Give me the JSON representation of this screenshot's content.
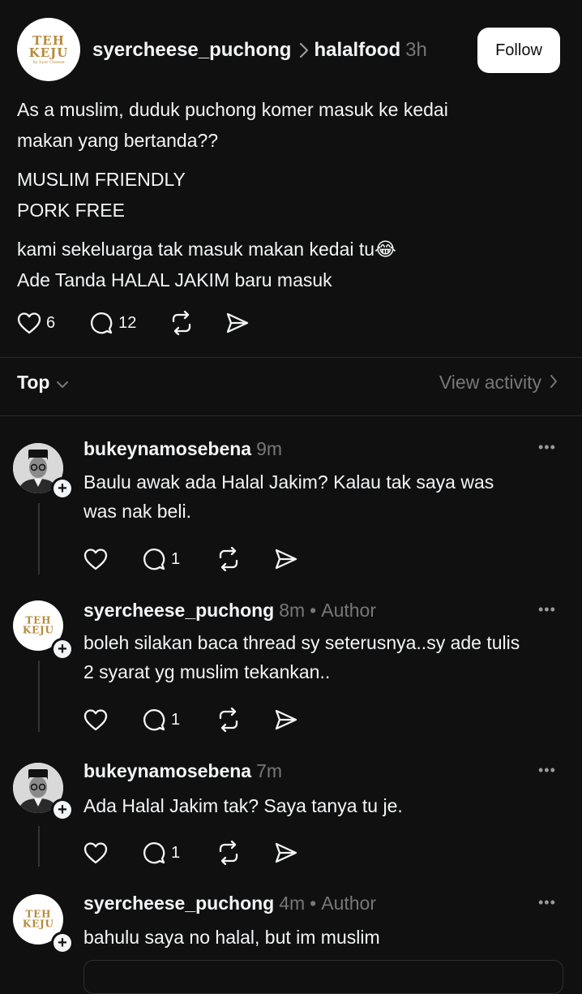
{
  "post": {
    "username": "syercheese_puchong",
    "topic": "halalfood",
    "time": "3h",
    "follow_label": "Follow",
    "avatar_logo": {
      "line1": "TEH",
      "line2": "KEJU",
      "line3": "by Syer Cheese"
    },
    "paragraphs": [
      [
        "As a muslim, duduk puchong komer masuk ke kedai",
        "makan yang bertanda??"
      ],
      [
        "MUSLIM FRIENDLY",
        "PORK FREE"
      ],
      [
        "kami sekeluarga tak masuk makan kedai tu😂",
        "Ade Tanda HALAL JAKIM baru masuk"
      ]
    ],
    "likes": "6",
    "comments": "12"
  },
  "sort": {
    "label": "Top",
    "view_activity": "View activity"
  },
  "replies": [
    {
      "username": "bukeynamosebena",
      "time": "9m",
      "author_tag": "",
      "lines": [
        "Baulu awak ada Halal Jakim? Kalau tak saya was",
        "was nak beli."
      ],
      "likes": "",
      "comments": "1"
    },
    {
      "username": "syercheese_puchong",
      "time": "8m",
      "author_tag": "Author",
      "lines": [
        "boleh silakan baca thread sy seterusnya..sy ade tulis",
        "2 syarat yg muslim tekankan.."
      ],
      "likes": "",
      "comments": "1"
    },
    {
      "username": "bukeynamosebena",
      "time": "7m",
      "author_tag": "",
      "lines": [
        "Ada Halal Jakim tak? Saya tanya tu je."
      ],
      "likes": "",
      "comments": "1"
    },
    {
      "username": "syercheese_puchong",
      "time": "4m",
      "author_tag": "Author",
      "lines": [
        "bahulu saya no halal, but im muslim"
      ],
      "likes": "",
      "comments": ""
    }
  ],
  "colors": {
    "background": "#101010",
    "text": "#f3f5f7",
    "muted": "#777777",
    "logo_gold": "#b68a3a"
  }
}
